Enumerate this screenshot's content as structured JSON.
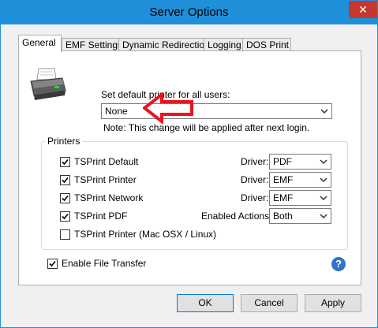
{
  "window": {
    "title": "Server Options",
    "close_glyph": "✕"
  },
  "tabs": [
    {
      "label": "General",
      "active": true
    },
    {
      "label": "EMF Settings"
    },
    {
      "label": "Dynamic Redirection"
    },
    {
      "label": "Logging"
    },
    {
      "label": "DOS Print"
    }
  ],
  "general": {
    "default_printer_label": "Set default printer for all users:",
    "default_printer_value": "None",
    "note": "Note: This change will be applied after next login.",
    "printers_group_title": "Printers",
    "printers": [
      {
        "label": "TSPrint Default",
        "checked": true,
        "option_label": "Driver:",
        "option_value": "PDF"
      },
      {
        "label": "TSPrint Printer",
        "checked": true,
        "option_label": "Driver:",
        "option_value": "EMF"
      },
      {
        "label": "TSPrint Network",
        "checked": true,
        "option_label": "Driver:",
        "option_value": "EMF"
      },
      {
        "label": "TSPrint PDF",
        "checked": true,
        "option_label": "Enabled Actions:",
        "option_value": "Both"
      },
      {
        "label": "TSPrint Printer (Mac OSX / Linux)",
        "checked": false
      }
    ],
    "enable_file_transfer": {
      "label": "Enable File Transfer",
      "checked": true
    },
    "help_glyph": "?"
  },
  "buttons": {
    "ok": "OK",
    "cancel": "Cancel",
    "apply": "Apply"
  },
  "colors": {
    "titlebar": "#1e8fd8",
    "close": "#c7372f",
    "annotation_arrow": "#e8141e"
  },
  "icons": {
    "printer": "printer-icon",
    "help": "help-icon",
    "annotation": "red-arrow-annotation"
  }
}
